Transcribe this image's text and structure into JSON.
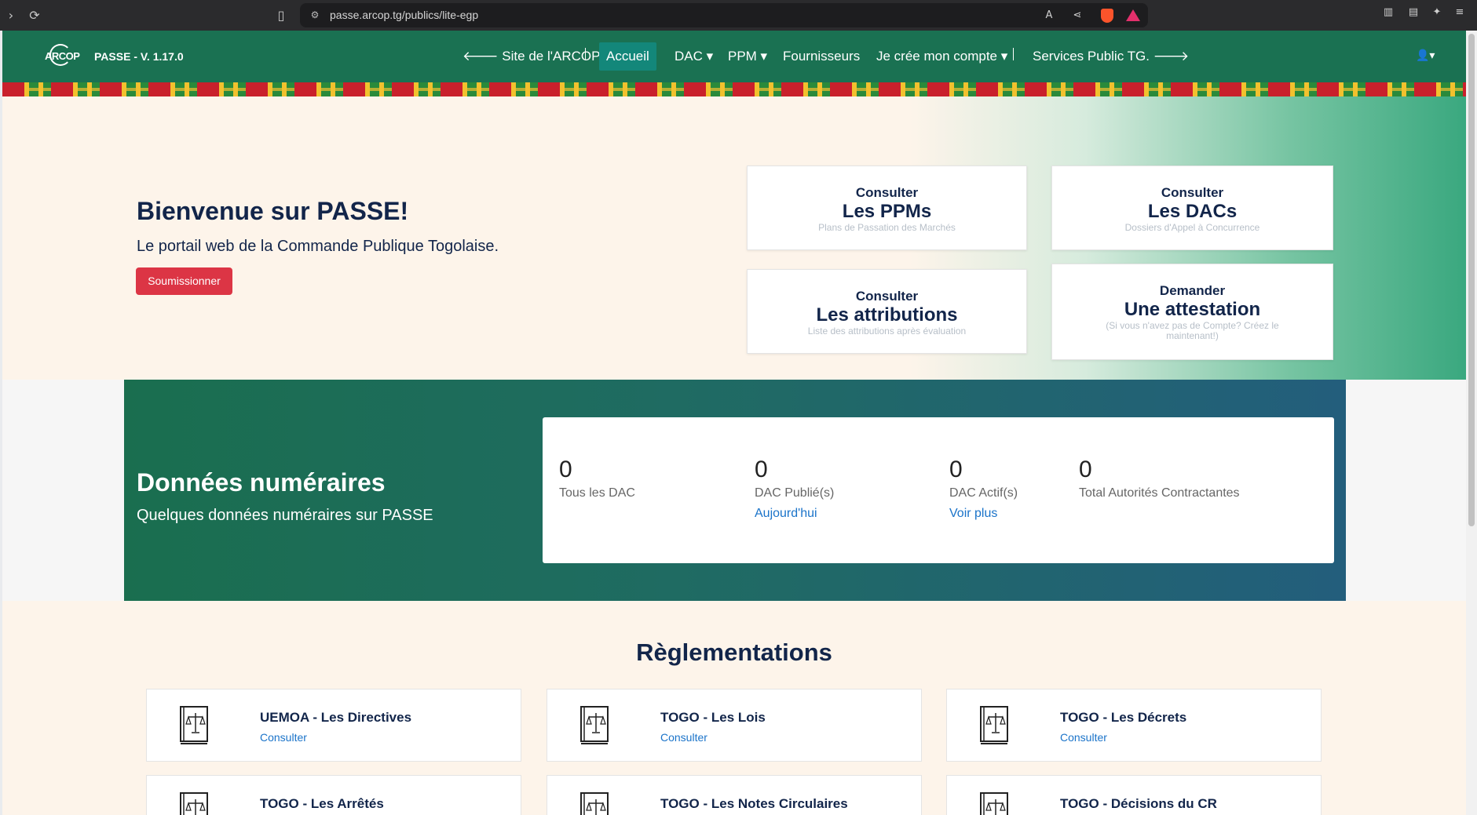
{
  "browser": {
    "url": "passe.arcop.tg/publics/lite-egp"
  },
  "nav": {
    "logo_text": "ARCOP",
    "brand": "PASSE - V. 1.17.0",
    "site_arcop": "🡐 Site de l'ARCOP",
    "accueil": "Accueil",
    "dac": "DAC ▾",
    "ppm": "PPM ▾",
    "fournisseurs": "Fournisseurs",
    "compte": "Je crée mon compte ▾",
    "services": "Services Public TG. 🡒",
    "user": "👤▾"
  },
  "hero": {
    "title": "Bienvenue sur PASSE!",
    "subtitle": "Le portail web de la Commande Publique Togolaise.",
    "button": "Soumissionner",
    "cards": [
      {
        "kicker": "Consulter",
        "title": "Les PPMs",
        "desc": "Plans de Passation des Marchés"
      },
      {
        "kicker": "Consulter",
        "title": "Les DACs",
        "desc": "Dossiers d'Appel à Concurrence"
      },
      {
        "kicker": "Consulter",
        "title": "Les attributions",
        "desc": "Liste des attributions après évaluation"
      },
      {
        "kicker": "Demander",
        "title": "Une attestation",
        "desc": "(Si vous n'avez pas de Compte? Créez le maintenant!)"
      }
    ]
  },
  "stats": {
    "title": "Données numéraires",
    "subtitle": "Quelques données numéraires sur PASSE",
    "items": [
      {
        "value": "0",
        "label": "Tous les DAC",
        "link": ""
      },
      {
        "value": "0",
        "label": "DAC Publié(s)",
        "link": "Aujourd'hui"
      },
      {
        "value": "0",
        "label": "DAC Actif(s)",
        "link": "Voir plus"
      },
      {
        "value": "0",
        "label": "Total Autorités Contractantes",
        "link": ""
      }
    ]
  },
  "regs": {
    "title": "Règlementations",
    "items": [
      {
        "title": "UEMOA - Les Directives",
        "link": "Consulter"
      },
      {
        "title": "TOGO - Les Lois",
        "link": "Consulter"
      },
      {
        "title": "TOGO - Les Décrets",
        "link": "Consulter"
      },
      {
        "title": "TOGO - Les Arrêtés",
        "link": ""
      },
      {
        "title": "TOGO - Les Notes Circulaires",
        "link": ""
      },
      {
        "title": "TOGO - Décisions du CR",
        "link": ""
      }
    ],
    "icon": "law-book-icon"
  },
  "colors": {
    "nav_green": "#1a7152",
    "navy": "#12254a",
    "red": "#dc3545",
    "link_blue": "#1a73c9"
  }
}
